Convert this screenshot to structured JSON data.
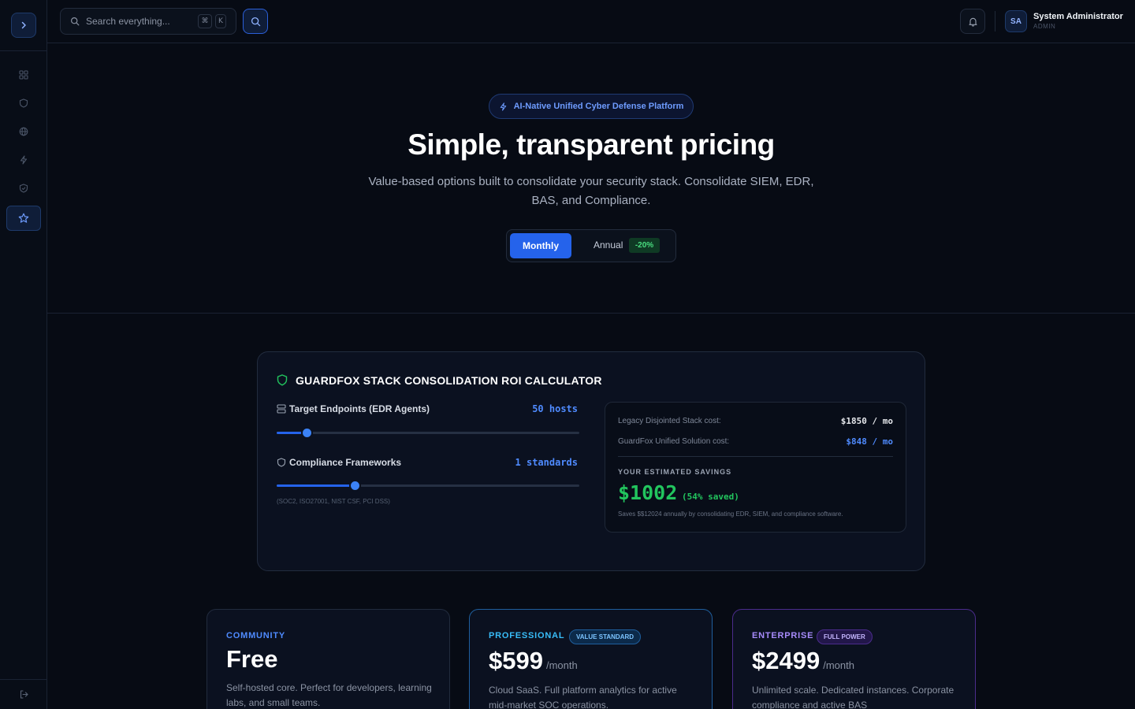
{
  "sidebar": {
    "toggle_icon": "chevron-right-icon",
    "items": [
      {
        "icon": "grid-icon",
        "active": false
      },
      {
        "icon": "shield-icon",
        "active": false
      },
      {
        "icon": "globe-icon",
        "active": false
      },
      {
        "icon": "zap-icon",
        "active": false
      },
      {
        "icon": "shield-check-icon",
        "active": false
      },
      {
        "icon": "star-icon",
        "active": true
      }
    ],
    "logout_icon": "logout-icon"
  },
  "header": {
    "search": {
      "placeholder": "Search everything...",
      "shortcut_keys": [
        "⌘",
        "K"
      ]
    },
    "user": {
      "initials": "SA",
      "name": "System Administrator",
      "role": "ADMIN"
    }
  },
  "hero": {
    "badge": "AI-Native Unified Cyber Defense Platform",
    "title": "Simple, transparent pricing",
    "subtitle": "Value-based options built to consolidate your security stack. Consolidate SIEM, EDR, BAS, and Compliance.",
    "billing": {
      "monthly": "Monthly",
      "annual": "Annual",
      "annual_discount": "-20%",
      "selected": "Monthly"
    }
  },
  "roi_calculator": {
    "title": "GUARDFOX STACK CONSOLIDATION ROI CALCULATOR",
    "endpoints": {
      "label": "Target Endpoints (EDR Agents)",
      "value_text": "50 hosts",
      "level": 0.1
    },
    "compliance": {
      "label": "Compliance Frameworks",
      "value_text": "1 standards",
      "level": 0.26,
      "hint": "(SOC2, ISO27001, NIST CSF, PCI DSS)"
    },
    "legacy": {
      "label": "Legacy Disjointed Stack cost:",
      "value": "$1850 / mo"
    },
    "guardfox": {
      "label": "GuardFox Unified Solution cost:",
      "value": "$848 / mo"
    },
    "savings": {
      "heading": "YOUR ESTIMATED SAVINGS",
      "amount": "$1002",
      "percent": "(54% saved)",
      "note": "Saves $$12024 annually by consolidating EDR, SIEM, and compliance software."
    }
  },
  "plans": [
    {
      "tier": "COMMUNITY",
      "badge": "",
      "price": "Free",
      "period": "",
      "description": "Self-hosted core. Perfect for developers, learning labs, and small teams."
    },
    {
      "tier": "PROFESSIONAL",
      "badge": "VALUE STANDARD",
      "price": "$599",
      "period": "/month",
      "description": "Cloud SaaS. Full platform analytics for active mid-market SOC operations."
    },
    {
      "tier": "ENTERPRISE",
      "badge": "FULL POWER",
      "price": "$2499",
      "period": "/month",
      "description": "Unlimited scale. Dedicated instances. Corporate compliance and active BAS"
    }
  ],
  "colors": {
    "accent": "#2563eb",
    "success": "#22c55e",
    "professional": "#38bdf8",
    "enterprise": "#a78bfa",
    "background": "#070b14"
  }
}
